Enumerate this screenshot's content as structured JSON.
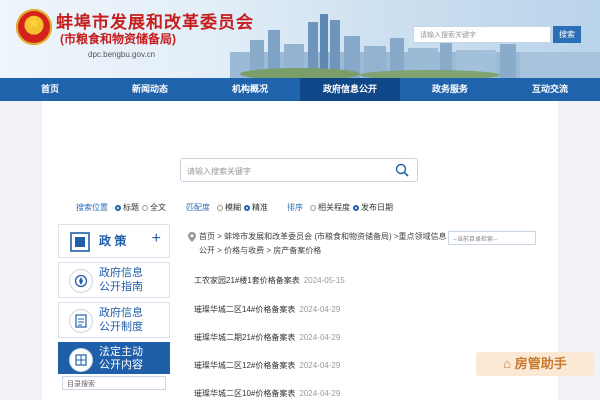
{
  "header": {
    "title": "蚌埠市发展和改革委员会",
    "subtitle": "(市粮食和物资储备局)",
    "domain": "dpc.bengbu.gov.cn",
    "search_placeholder": "请输入搜索关键字",
    "search_button": "搜索"
  },
  "nav": [
    "首页",
    "新闻动态",
    "机构概况",
    "政府信息公开",
    "政务服务",
    "互动交流"
  ],
  "main_search": {
    "placeholder": "请输入搜索关键字"
  },
  "filters": {
    "position": {
      "label": "搜索位置",
      "options": [
        "标题",
        "全文"
      ]
    },
    "match": {
      "label": "匹配度",
      "options": [
        "模糊",
        "精准"
      ]
    },
    "sort": {
      "label": "排序",
      "options": [
        "相关程度",
        "发布日期"
      ]
    }
  },
  "sidebar": {
    "policy": "政 策",
    "plus": "+",
    "guide": [
      "政府信息",
      "公开指南"
    ],
    "system": [
      "政府信息",
      "公开制度"
    ],
    "active": [
      "法定主动",
      "公开内容"
    ],
    "dir_search": "目录搜索"
  },
  "breadcrumb": {
    "line1": "首页 > 蚌埠市发展和改革委员会 (市粮食和物资储备局) >重点领域信息",
    "line2": "公开 > 价格与收费 > 房产备案价格",
    "current_dir_placeholder": "--当前目录检索--"
  },
  "list": [
    {
      "title": "工农家园21#楼1套价格备案表",
      "date": "2024-05-15"
    },
    {
      "title": "璀璨华城二区14#价格备案表",
      "date": "2024-04-29"
    },
    {
      "title": "璀璨华城二期21#价格备案表",
      "date": "2024-04-29"
    },
    {
      "title": "璀璨华城二区12#价格备案表",
      "date": "2024-04-29"
    },
    {
      "title": "璀璨华城二区10#价格备案表",
      "date": "2024-04-29"
    }
  ],
  "watermark": "房管助手",
  "colors": {
    "nav_bg": "#1f63ad",
    "title_red": "#c61d1d",
    "accent_blue": "#1f5ea8"
  }
}
